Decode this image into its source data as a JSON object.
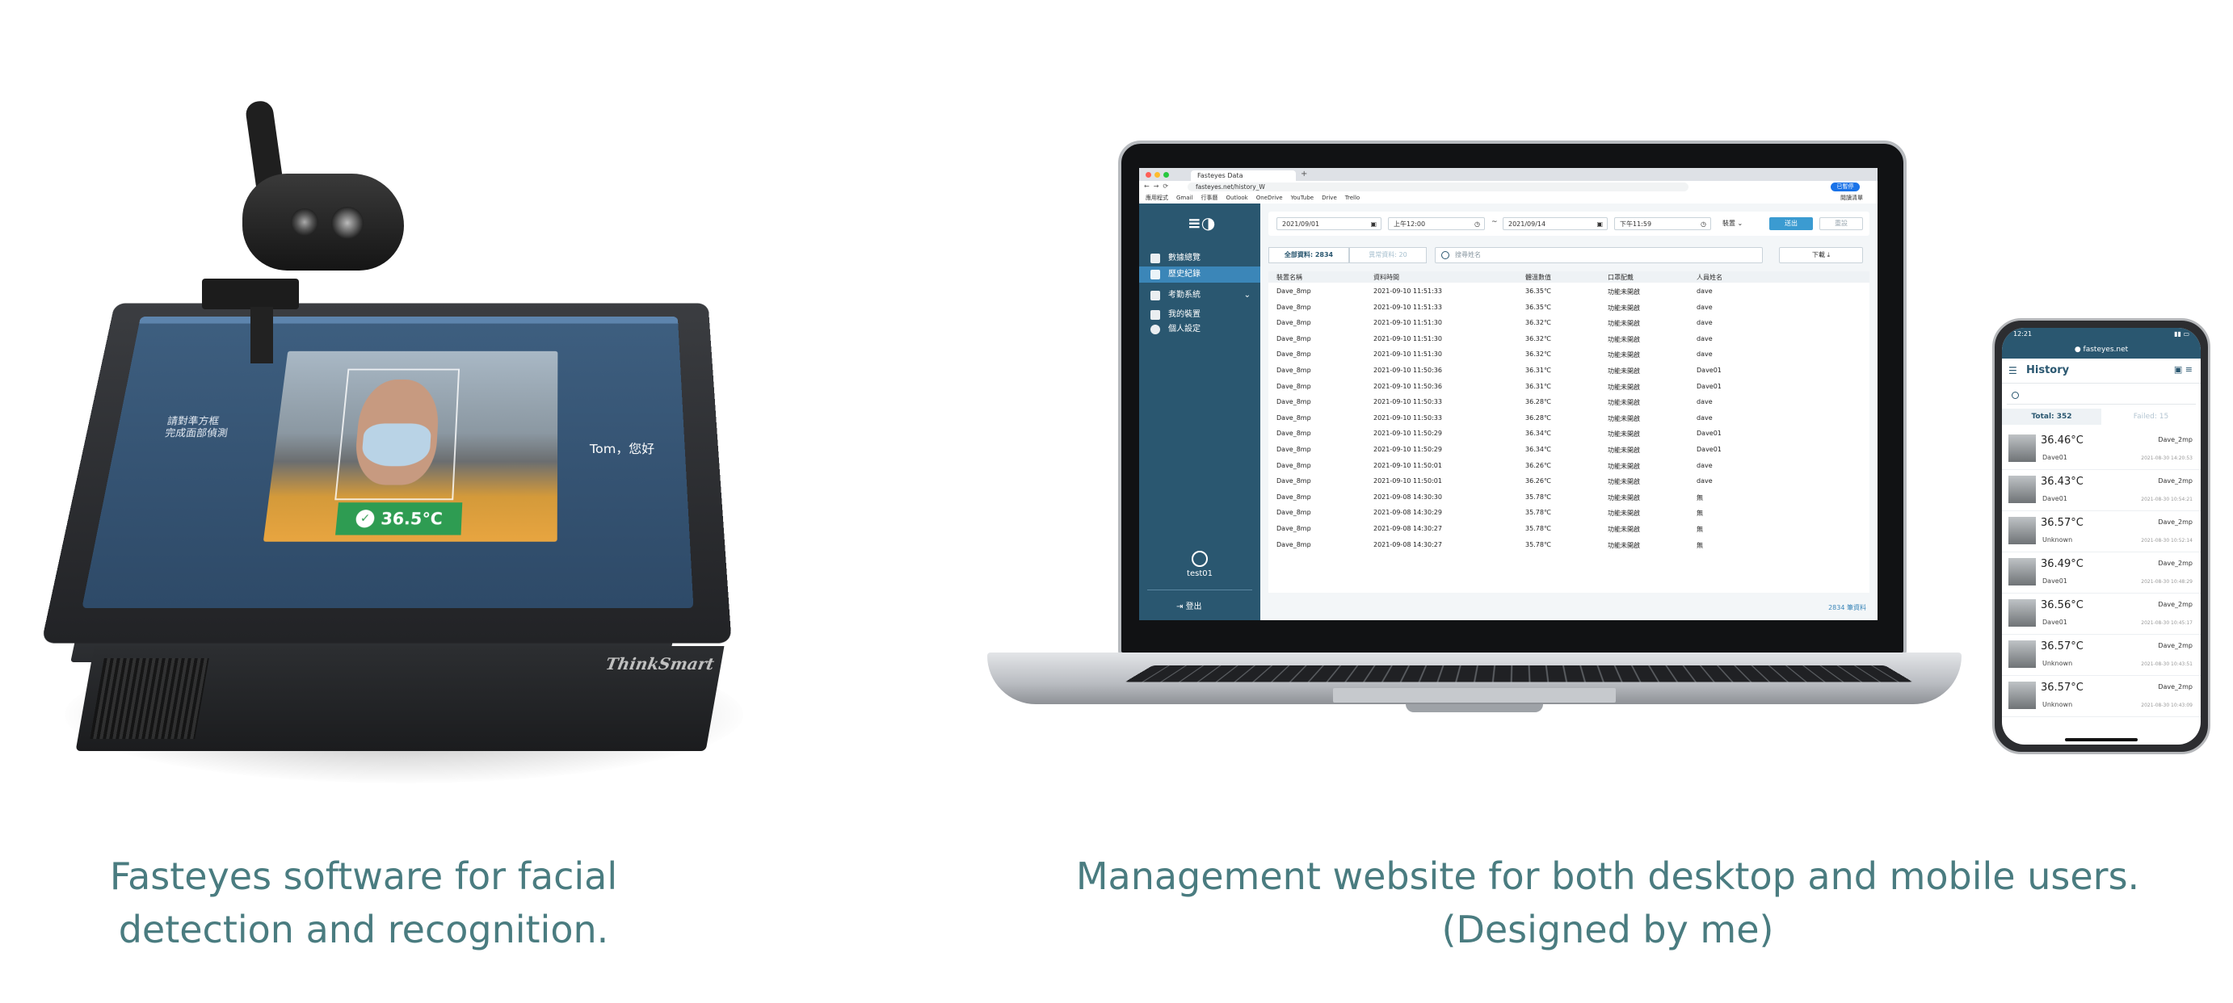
{
  "captions": {
    "left_line1": "Fasteyes software for facial",
    "left_line2": "detection and recognition.",
    "right_line1": "Management website for both desktop and mobile users.",
    "right_line2": "(Designed by me)"
  },
  "kiosk": {
    "brand": "ThinkSmart",
    "screen_temp": "36.5°C",
    "screen_name": "Tom，您好",
    "screen_left_text": "請對準方框\n完成面部偵測"
  },
  "desktop": {
    "tab_title": "Fasteyes Data",
    "url": "fasteyes.net/history_W",
    "profile": "已暫停",
    "bookmarks": [
      "應用程式",
      "Gmail",
      "行事曆",
      "Outlook",
      "OneDrive",
      "YouTube",
      "Drive",
      "Trello",
      "閱讀清單"
    ],
    "sidebar": {
      "items": [
        {
          "label": "數據總覽",
          "icon": "dashboard-icon"
        },
        {
          "label": "歷史紀錄",
          "icon": "history-icon"
        },
        {
          "label": "考勤系統",
          "icon": "attendance-icon"
        },
        {
          "label": "我的裝置",
          "icon": "device-icon"
        },
        {
          "label": "個人設定",
          "icon": "gear-icon"
        }
      ],
      "user": "test01",
      "logout": "登出"
    },
    "filters": {
      "start_date": "2021/09/01",
      "start_time": "上午12:00",
      "separator": "~",
      "end_date": "2021/09/14",
      "end_time": "下午11:59",
      "device": "裝置",
      "search_button": "送出",
      "reset_button": "重設"
    },
    "stats": {
      "all": "全部資料: 2834",
      "failed": "異常資料: 20",
      "search_placeholder": "搜尋姓名",
      "download": "下載"
    },
    "table": {
      "columns": [
        "裝置名稱",
        "資料時間",
        "體溫數值",
        "口罩配戴",
        "人員姓名"
      ],
      "rows": [
        [
          "Dave_8mp",
          "2021-09-10 11:51:33",
          "36.35℃",
          "功能未開啟",
          "dave"
        ],
        [
          "Dave_8mp",
          "2021-09-10 11:51:33",
          "36.35℃",
          "功能未開啟",
          "dave"
        ],
        [
          "Dave_8mp",
          "2021-09-10 11:51:30",
          "36.32℃",
          "功能未開啟",
          "dave"
        ],
        [
          "Dave_8mp",
          "2021-09-10 11:51:30",
          "36.32℃",
          "功能未開啟",
          "dave"
        ],
        [
          "Dave_8mp",
          "2021-09-10 11:51:30",
          "36.32℃",
          "功能未開啟",
          "dave"
        ],
        [
          "Dave_8mp",
          "2021-09-10 11:50:36",
          "36.31℃",
          "功能未開啟",
          "Dave01"
        ],
        [
          "Dave_8mp",
          "2021-09-10 11:50:36",
          "36.31℃",
          "功能未開啟",
          "Dave01"
        ],
        [
          "Dave_8mp",
          "2021-09-10 11:50:33",
          "36.28℃",
          "功能未開啟",
          "dave"
        ],
        [
          "Dave_8mp",
          "2021-09-10 11:50:33",
          "36.28℃",
          "功能未開啟",
          "dave"
        ],
        [
          "Dave_8mp",
          "2021-09-10 11:50:29",
          "36.34℃",
          "功能未開啟",
          "Dave01"
        ],
        [
          "Dave_8mp",
          "2021-09-10 11:50:29",
          "36.34℃",
          "功能未開啟",
          "Dave01"
        ],
        [
          "Dave_8mp",
          "2021-09-10 11:50:01",
          "36.26℃",
          "功能未開啟",
          "dave"
        ],
        [
          "Dave_8mp",
          "2021-09-10 11:50:01",
          "36.26℃",
          "功能未開啟",
          "dave"
        ],
        [
          "Dave_8mp",
          "2021-09-08 14:30:30",
          "35.78℃",
          "功能未開啟",
          "無"
        ],
        [
          "Dave_8mp",
          "2021-09-08 14:30:29",
          "35.78℃",
          "功能未開啟",
          "無"
        ],
        [
          "Dave_8mp",
          "2021-09-08 14:30:27",
          "35.78℃",
          "功能未開啟",
          "無"
        ],
        [
          "Dave_8mp",
          "2021-09-08 14:30:27",
          "35.78℃",
          "功能未開啟",
          "無"
        ]
      ]
    },
    "footer_count": "2834 筆資料"
  },
  "mobile": {
    "time": "12:21",
    "url": "fasteyes.net",
    "title": "History",
    "tab_total": "Total: 352",
    "tab_failed": "Failed: 15",
    "rows": [
      {
        "temp": "36.46°C",
        "device": "Dave_2mp",
        "name": "Dave01",
        "time": "2021-08-30 14:20:53"
      },
      {
        "temp": "36.43°C",
        "device": "Dave_2mp",
        "name": "Dave01",
        "time": "2021-08-30 10:54:21"
      },
      {
        "temp": "36.57°C",
        "device": "Dave_2mp",
        "name": "Unknown",
        "time": "2021-08-30 10:52:14"
      },
      {
        "temp": "36.49°C",
        "device": "Dave_2mp",
        "name": "Dave01",
        "time": "2021-08-30 10:48:29"
      },
      {
        "temp": "36.56°C",
        "device": "Dave_2mp",
        "name": "Dave01",
        "time": "2021-08-30 10:45:17"
      },
      {
        "temp": "36.57°C",
        "device": "Dave_2mp",
        "name": "Unknown",
        "time": "2021-08-30 10:43:51"
      },
      {
        "temp": "36.57°C",
        "device": "Dave_2mp",
        "name": "Unknown",
        "time": "2021-08-30 10:43:09"
      }
    ]
  },
  "colors": {
    "caption": "#4a7c80",
    "sidebar": "#2a5770",
    "accent": "#3b9bd1",
    "temp_badge": "#2e9c52"
  }
}
